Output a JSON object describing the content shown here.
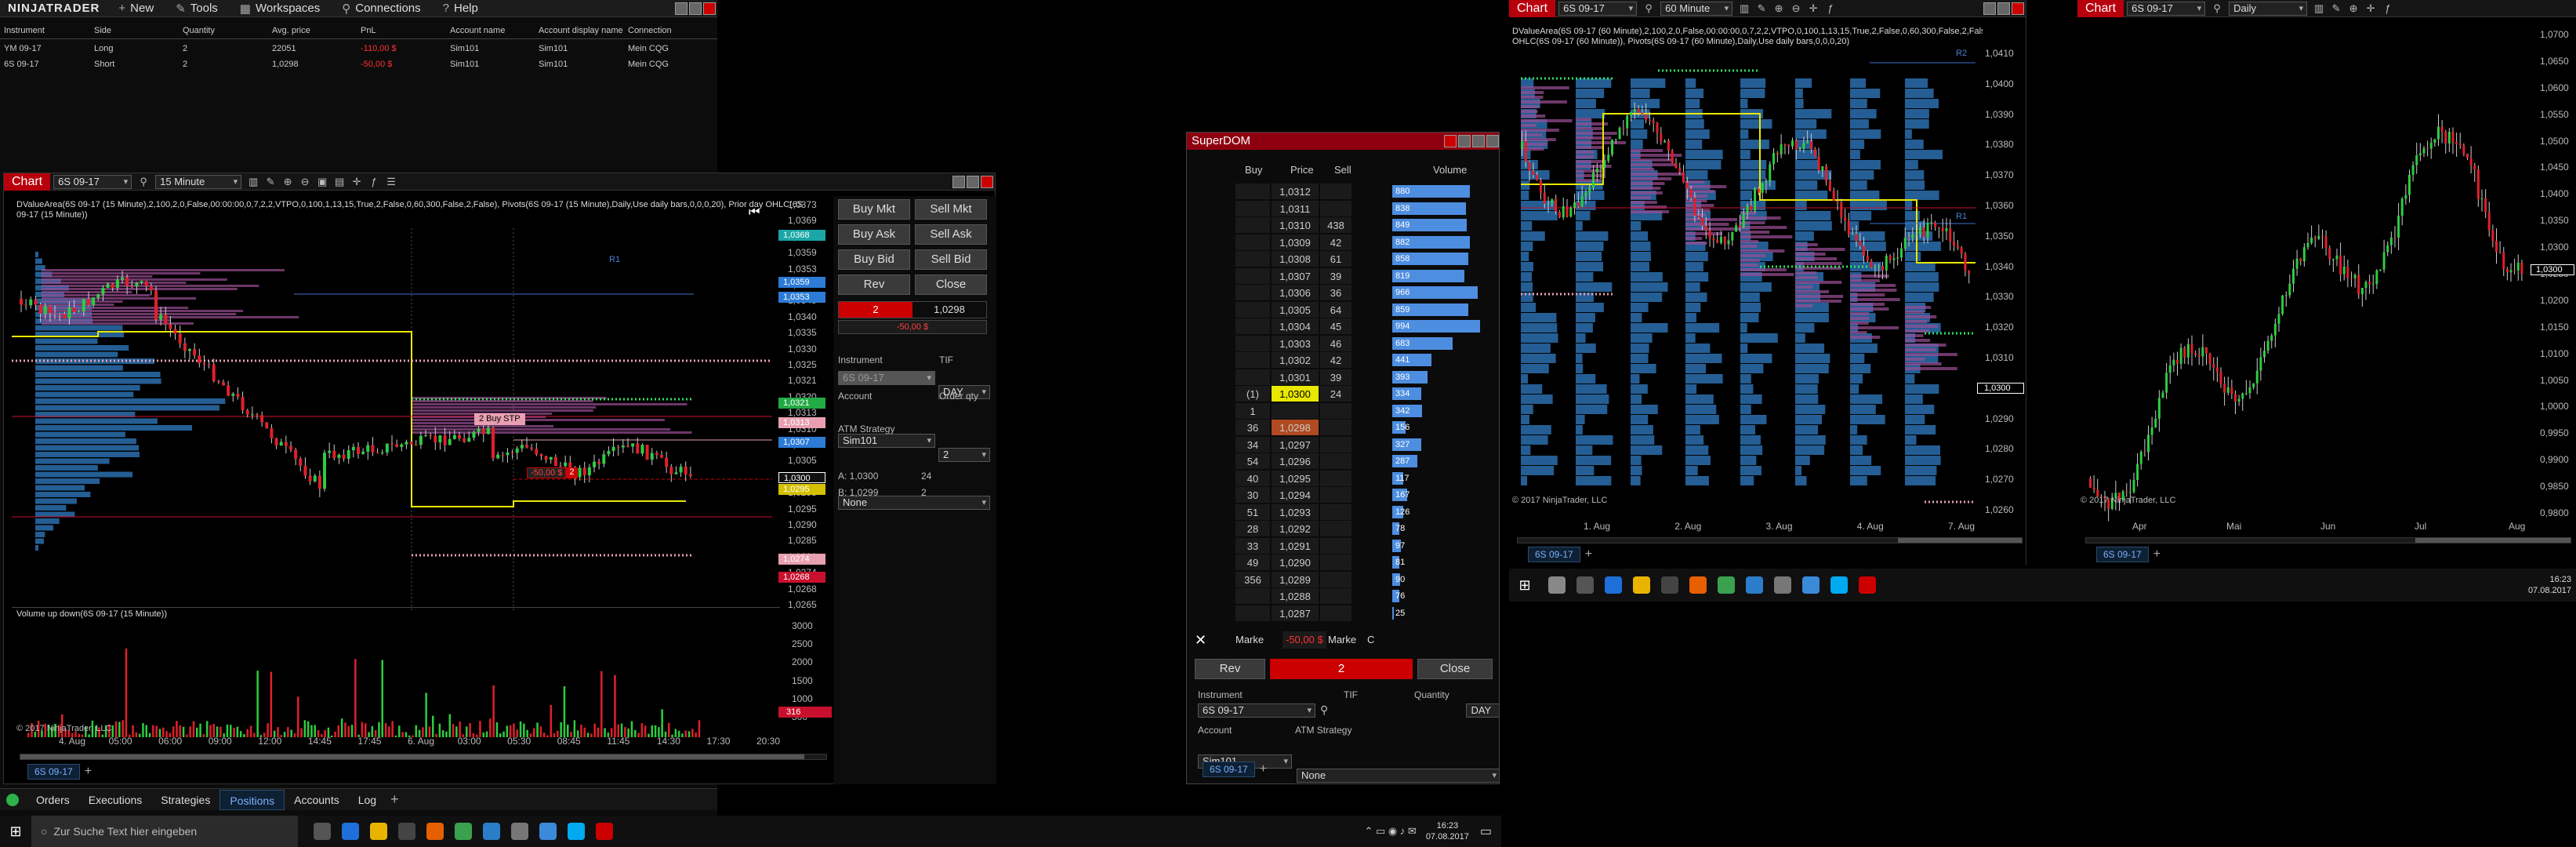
{
  "control_center": {
    "logo": "NINJATRADER",
    "menu": [
      {
        "icon": "plus-icon",
        "glyph": "+",
        "label": "New"
      },
      {
        "icon": "wrench-icon",
        "glyph": "✎",
        "label": "Tools"
      },
      {
        "icon": "workspaces-icon",
        "glyph": "▦",
        "label": "Workspaces"
      },
      {
        "icon": "plug-icon",
        "glyph": "⚲",
        "label": "Connections"
      },
      {
        "icon": "help-icon",
        "glyph": "?",
        "label": "Help"
      }
    ],
    "columns": [
      "Instrument",
      "Side",
      "Quantity",
      "Avg. price",
      "PnL",
      "Account name",
      "Account display name",
      "Connection"
    ],
    "rows": [
      [
        "YM 09-17",
        "Long",
        "2",
        "22051",
        "-110,00 $",
        "Sim101",
        "Sim101",
        "Mein CQG"
      ],
      [
        "6S 09-17",
        "Short",
        "2",
        "1,0298",
        "-50,00 $",
        "Sim101",
        "Sim101",
        "Mein CQG"
      ]
    ],
    "tabs": [
      "Orders",
      "Executions",
      "Strategies",
      "Positions",
      "Accounts",
      "Log"
    ],
    "active_tab": "Positions"
  },
  "chart1": {
    "title": "Chart",
    "instrument": "6S 09-17",
    "interval": "15 Minute",
    "header_line1": "DValueArea(6S 09-17 (15 Minute),2,100,2,0,False,00:00:00,0,7,2,2,VTPO,0,100,1,13,15,True,2,False,0,60,300,False,2,False), Pivots(6S 09-17 (15 Minute),Daily,Use daily bars,0,0,0,20), Prior day OHLC(6S",
    "header_line2": "09-17 (15 Minute))",
    "price_axis": [
      "1,0373",
      "1,0369",
      "1,0365",
      "1,0359",
      "1,0353",
      "1,0350",
      "1,0345",
      "1,0340",
      "1,0335",
      "1,0330",
      "1,0325",
      "1,0321",
      "1,0320",
      "1,0313",
      "1,0310",
      "1,0307",
      "1,0305",
      "1,0300",
      "1,0298",
      "1,0295",
      "1,0290",
      "1,0285",
      "1,0280",
      "1,0274",
      "1,0268",
      "1,0265"
    ],
    "price_tags": [
      {
        "label": "1,0368",
        "color": "#1aa6a6"
      },
      {
        "label": "1,0359",
        "color": "#2c7bd6"
      },
      {
        "label": "1,0353",
        "color": "#2c7bd6"
      },
      {
        "label": "1,0321",
        "color": "#22aa44"
      },
      {
        "label": "1,0313",
        "color": "#e8a0b0"
      },
      {
        "label": "1,0307",
        "color": "#2c7bd6"
      },
      {
        "label": "1,0300",
        "color": "#111111"
      },
      {
        "label": "1,0295",
        "color": "#d4c000"
      },
      {
        "label": "1,0274",
        "color": "#e8a0b0"
      },
      {
        "label": "1,0268",
        "color": "#c8102e"
      }
    ],
    "r1_label": "R1",
    "order_label": "2 Buy STP",
    "pnl_marker": "-50,00 $",
    "pnl_qty": "2",
    "time_axis": [
      "4. Aug",
      "05:00",
      "06:00",
      "09:00",
      "12:00",
      "14:45",
      "17:45",
      "6. Aug",
      "03:00",
      "05:30",
      "08:45",
      "11:45",
      "14:30",
      "17:30",
      "20:30"
    ],
    "volume_title": "Volume up down(6S 09-17 (15 Minute))",
    "volume_axis": [
      "3000",
      "2500",
      "2000",
      "1500",
      "1000",
      "500"
    ],
    "volume_tag": "316",
    "copyright": "© 2017 NinjaTrader, LLC",
    "tab": "6S 09-17"
  },
  "order_panel": {
    "buttons": [
      [
        "Buy Mkt",
        "Sell Mkt"
      ],
      [
        "Buy Ask",
        "Sell Ask"
      ],
      [
        "Buy Bid",
        "Sell Bid"
      ],
      [
        "Rev",
        "Close"
      ]
    ],
    "position_qty": "2",
    "position_price": "1,0298",
    "position_pnl": "-50,00 $",
    "instrument_label": "Instrument",
    "instrument_value": "6S 09-17",
    "tif_label": "TIF",
    "tif_value": "DAY",
    "account_label": "Account",
    "account_value": "Sim101",
    "orderqty_label": "Order qty",
    "orderqty_value": "2",
    "atm_label": "ATM Strategy",
    "atm_value": "None",
    "ask_line": "A: 1,0300",
    "ask_size": "24",
    "bid_line": "B: 1,0299",
    "bid_size": "2"
  },
  "superdom": {
    "title": "SuperDOM",
    "columns": [
      "Buy",
      "Price",
      "Sell",
      "Volume"
    ],
    "rows": [
      {
        "buy": "",
        "price": "1,0312",
        "sell": "",
        "vol": "880",
        "vf": 0.8
      },
      {
        "buy": "",
        "price": "1,0311",
        "sell": "",
        "vol": "838",
        "vf": 0.76
      },
      {
        "buy": "",
        "price": "1,0310",
        "sell": "438",
        "vol": "849",
        "vf": 0.77
      },
      {
        "buy": "",
        "price": "1,0309",
        "sell": "42",
        "vol": "882",
        "vf": 0.8
      },
      {
        "buy": "",
        "price": "1,0308",
        "sell": "61",
        "vol": "858",
        "vf": 0.78
      },
      {
        "buy": "",
        "price": "1,0307",
        "sell": "39",
        "vol": "819",
        "vf": 0.74
      },
      {
        "buy": "",
        "price": "1,0306",
        "sell": "36",
        "vol": "966",
        "vf": 0.88
      },
      {
        "buy": "",
        "price": "1,0305",
        "sell": "64",
        "vol": "859",
        "vf": 0.78
      },
      {
        "buy": "",
        "price": "1,0304",
        "sell": "45",
        "vol": "994",
        "vf": 0.9
      },
      {
        "buy": "",
        "price": "1,0303",
        "sell": "46",
        "vol": "683",
        "vf": 0.62
      },
      {
        "buy": "",
        "price": "1,0302",
        "sell": "42",
        "vol": "441",
        "vf": 0.4
      },
      {
        "buy": "",
        "price": "1,0301",
        "sell": "39",
        "vol": "393",
        "vf": 0.36
      },
      {
        "buy": "(1)",
        "price": "1,0300",
        "sell": "24",
        "vol": "334",
        "vf": 0.3,
        "hl": "ask"
      },
      {
        "buy": "1",
        "price": "",
        "sell": "",
        "vol": "342",
        "vf": 0.31
      },
      {
        "buy": "36",
        "price": "1,0298",
        "sell": "",
        "vol": "156",
        "vf": 0.14,
        "hl": "last"
      },
      {
        "buy": "34",
        "price": "1,0297",
        "sell": "",
        "vol": "327",
        "vf": 0.3
      },
      {
        "buy": "54",
        "price": "1,0296",
        "sell": "",
        "vol": "287",
        "vf": 0.26
      },
      {
        "buy": "40",
        "price": "1,0295",
        "sell": "",
        "vol": "117",
        "vf": 0.11
      },
      {
        "buy": "30",
        "price": "1,0294",
        "sell": "",
        "vol": "167",
        "vf": 0.15
      },
      {
        "buy": "51",
        "price": "1,0293",
        "sell": "",
        "vol": "126",
        "vf": 0.11
      },
      {
        "buy": "28",
        "price": "1,0292",
        "sell": "",
        "vol": "78",
        "vf": 0.07
      },
      {
        "buy": "33",
        "price": "1,0291",
        "sell": "",
        "vol": "97",
        "vf": 0.09
      },
      {
        "buy": "49",
        "price": "1,0290",
        "sell": "",
        "vol": "81",
        "vf": 0.07
      },
      {
        "buy": "356",
        "price": "1,0289",
        "sell": "",
        "vol": "90",
        "vf": 0.08
      },
      {
        "buy": "",
        "price": "1,0288",
        "sell": "",
        "vol": "76",
        "vf": 0.07
      },
      {
        "buy": "",
        "price": "1,0287",
        "sell": "",
        "vol": "25",
        "vf": 0.02
      }
    ],
    "market_left": "Marke",
    "market_pnl": "-50,00 $",
    "market_right": "Marke",
    "c_label": "C",
    "rev": "Rev",
    "qty": "2",
    "close": "Close",
    "instrument_label": "Instrument",
    "instrument_value": "6S 09-17",
    "tif_label": "TIF",
    "tif_value": "DAY",
    "quantity_label": "Quantity",
    "quantity_value": "2",
    "account_label": "Account",
    "account_value": "Sim101",
    "atm_label": "ATM Strategy",
    "atm_value": "None",
    "tab": "6S 09-17"
  },
  "chart2": {
    "title": "Chart",
    "instrument": "6S 09-17",
    "interval": "60 Minute",
    "header_line1": "DValueArea(6S 09-17 (60 Minute),2,100,2,0,False,00:00:00,0,7,2,2,VTPO,0,100,1,13,15,True,2,False,0,60,300,False,2,False), Prior day",
    "header_line2": "OHLC(6S 09-17 (60 Minute)), Pivots(6S 09-17 (60 Minute),Daily,Use daily bars,0,0,0,20)",
    "price_axis": [
      "1,0410",
      "1,0400",
      "1,0390",
      "1,0380",
      "1,0370",
      "1,0360",
      "1,0350",
      "1,0340",
      "1,0330",
      "1,0320",
      "1,0310",
      "1,0300",
      "1,0290",
      "1,0280",
      "1,0270",
      "1,0260"
    ],
    "r_labels": [
      "R2",
      "R1"
    ],
    "current_tag": "1,0300",
    "time_axis": [
      "1. Aug",
      "2. Aug",
      "3. Aug",
      "4. Aug",
      "7. Aug"
    ],
    "copyright": "© 2017 NinjaTrader, LLC",
    "tab": "6S 09-17"
  },
  "chart3": {
    "title": "Chart",
    "instrument": "6S 09-17",
    "interval": "Daily",
    "price_axis": [
      "1,0700",
      "1,0650",
      "1,0600",
      "1,0550",
      "1,0500",
      "1,0450",
      "1,0400",
      "1,0350",
      "1,0300",
      "1,0250",
      "1,0200",
      "1,0150",
      "1,0100",
      "1,0050",
      "1,0000",
      "0,9950",
      "0,9900",
      "0,9850",
      "0,9800"
    ],
    "current_tag": "1,0300",
    "time_axis": [
      "Apr",
      "Mai",
      "Jun",
      "Jul",
      "Aug"
    ],
    "copyright": "© 2017 NinjaTrader, LLC",
    "tab": "6S 09-17"
  },
  "taskbar_left": {
    "search_placeholder": "Zur Suche Text hier eingeben",
    "time": "16:23",
    "date": "07.08.2017"
  },
  "taskbar_right": {
    "time": "16:23",
    "date": "07.08.2017"
  }
}
